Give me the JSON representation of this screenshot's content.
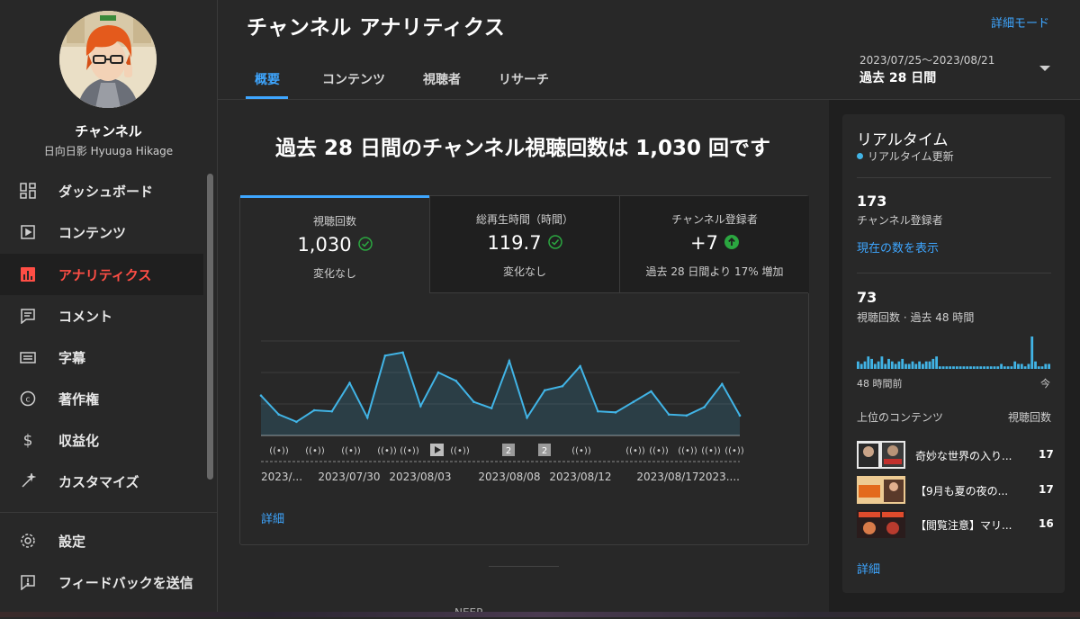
{
  "channel": {
    "name": "チャンネル",
    "handle": "日向日影 Hyuuga Hikage"
  },
  "sidebar": {
    "items": [
      {
        "label": "ダッシュボード",
        "icon": "dashboard-icon"
      },
      {
        "label": "コンテンツ",
        "icon": "content-icon"
      },
      {
        "label": "アナリティクス",
        "icon": "analytics-icon",
        "active": true
      },
      {
        "label": "コメント",
        "icon": "comment-icon"
      },
      {
        "label": "字幕",
        "icon": "subtitles-icon"
      },
      {
        "label": "著作権",
        "icon": "copyright-icon"
      },
      {
        "label": "収益化",
        "icon": "dollar-icon"
      },
      {
        "label": "カスタマイズ",
        "icon": "magic-wand-icon"
      }
    ],
    "footer": [
      {
        "label": "設定",
        "icon": "gear-icon"
      },
      {
        "label": "フィードバックを送信",
        "icon": "feedback-icon"
      }
    ]
  },
  "header": {
    "title": "チャンネル アナリティクス",
    "detail_mode": "詳細モード",
    "tabs": [
      {
        "label": "概要",
        "active": true
      },
      {
        "label": "コンテンツ"
      },
      {
        "label": "視聴者"
      },
      {
        "label": "リサーチ"
      }
    ],
    "date_range": "2023/07/25～2023/08/21",
    "date_period": "過去 28 日間"
  },
  "main": {
    "headline": "過去 28 日間のチャンネル視聴回数は 1,030 回です",
    "metrics": [
      {
        "label": "視聴回数",
        "value": "1,030",
        "sub": "変化なし",
        "status": "check"
      },
      {
        "label": "総再生時間（時間）",
        "value": "119.7",
        "sub": "変化なし",
        "status": "check"
      },
      {
        "label": "チャンネル登録者",
        "value": "+7",
        "sub": "過去 28 日間より 17% 増加",
        "status": "up"
      }
    ],
    "detail_link": "詳細",
    "bottom_text": "NEEP ..."
  },
  "chart_data": {
    "type": "area",
    "y_ticks": [
      "90",
      "60",
      "30",
      "0"
    ],
    "ylim": [
      0,
      90
    ],
    "x_tick_labels": [
      "2023/...",
      "2023/07/30",
      "2023/08/03",
      "2023/08/08",
      "2023/08/12",
      "2023/08/17",
      "2023...."
    ],
    "values": [
      38,
      20,
      13,
      24,
      23,
      50,
      17,
      76,
      79,
      28,
      60,
      52,
      32,
      26,
      71,
      17,
      43,
      47,
      66,
      23,
      22,
      32,
      42,
      20,
      19,
      27,
      49,
      19
    ],
    "markers": [
      "live",
      "live",
      "live",
      "live",
      "live",
      "live",
      "video",
      "live",
      "2",
      "2",
      "live",
      "live",
      "live",
      "live",
      "live",
      "live",
      "live"
    ],
    "color": "#41b4e6"
  },
  "realtime": {
    "title": "リアルタイム",
    "subtitle": "リアルタイム更新",
    "subs_count": "173",
    "subs_label": "チャンネル登録者",
    "show_count": "現在の数を表示",
    "views_count": "73",
    "views_label": "視聴回数 · 過去 48 時間",
    "bars": [
      3,
      2,
      3,
      5,
      4,
      2,
      3,
      5,
      2,
      4,
      3,
      2,
      3,
      4,
      2,
      2,
      3,
      2,
      3,
      2,
      3,
      3,
      4,
      5,
      1,
      1,
      1,
      1,
      1,
      1,
      1,
      1,
      1,
      1,
      1,
      1,
      1,
      1,
      1,
      1,
      1,
      1,
      2,
      1,
      1,
      1,
      3,
      2,
      2,
      1,
      2,
      13,
      3,
      1,
      1,
      2,
      2
    ],
    "axis_start": "48 時間前",
    "axis_end": "今",
    "top_content_label": "上位のコンテンツ",
    "top_views_label": "視聴回数",
    "top": [
      {
        "title": "奇妙な世界の入り...",
        "views": "17"
      },
      {
        "title": "【9月も夏の夜の...",
        "views": "17"
      },
      {
        "title": "【閲覧注意】マリ...",
        "views": "16"
      }
    ],
    "detail_link": "詳細"
  }
}
